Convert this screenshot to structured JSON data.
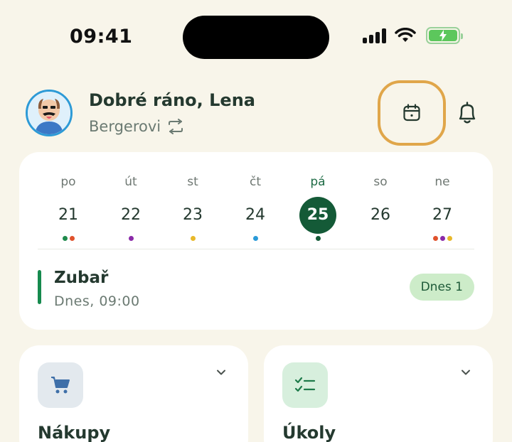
{
  "status": {
    "time": "09:41"
  },
  "header": {
    "greeting": "Dobré ráno, Lena",
    "family": "Bergerovi"
  },
  "week": {
    "days": [
      {
        "name": "po",
        "num": "21",
        "dots": [
          "#1f8a4c",
          "#e0522c"
        ]
      },
      {
        "name": "út",
        "num": "22",
        "dots": [
          "#8a2aa8"
        ]
      },
      {
        "name": "st",
        "num": "23",
        "dots": [
          "#e8b82a"
        ]
      },
      {
        "name": "čt",
        "num": "24",
        "dots": [
          "#2a9ad8"
        ]
      },
      {
        "name": "pá",
        "num": "25",
        "active": true,
        "dots": [
          "#145a37"
        ]
      },
      {
        "name": "so",
        "num": "26",
        "dots": []
      },
      {
        "name": "ne",
        "num": "27",
        "dots": [
          "#e0522c",
          "#8a2aa8",
          "#e8b82a"
        ]
      }
    ]
  },
  "event": {
    "title": "Zubař",
    "time": "Dnes, 09:00",
    "badge": "Dnes 1",
    "color": "#168a4e"
  },
  "tiles": {
    "shopping": {
      "title": "Nákupy",
      "icon": "cart-icon"
    },
    "tasks": {
      "title": "Úkoly",
      "icon": "checklist-icon"
    }
  },
  "colors": {
    "accent": "#145a37",
    "highlight_ring": "#e0a64a",
    "background": "#f8f5ea"
  }
}
